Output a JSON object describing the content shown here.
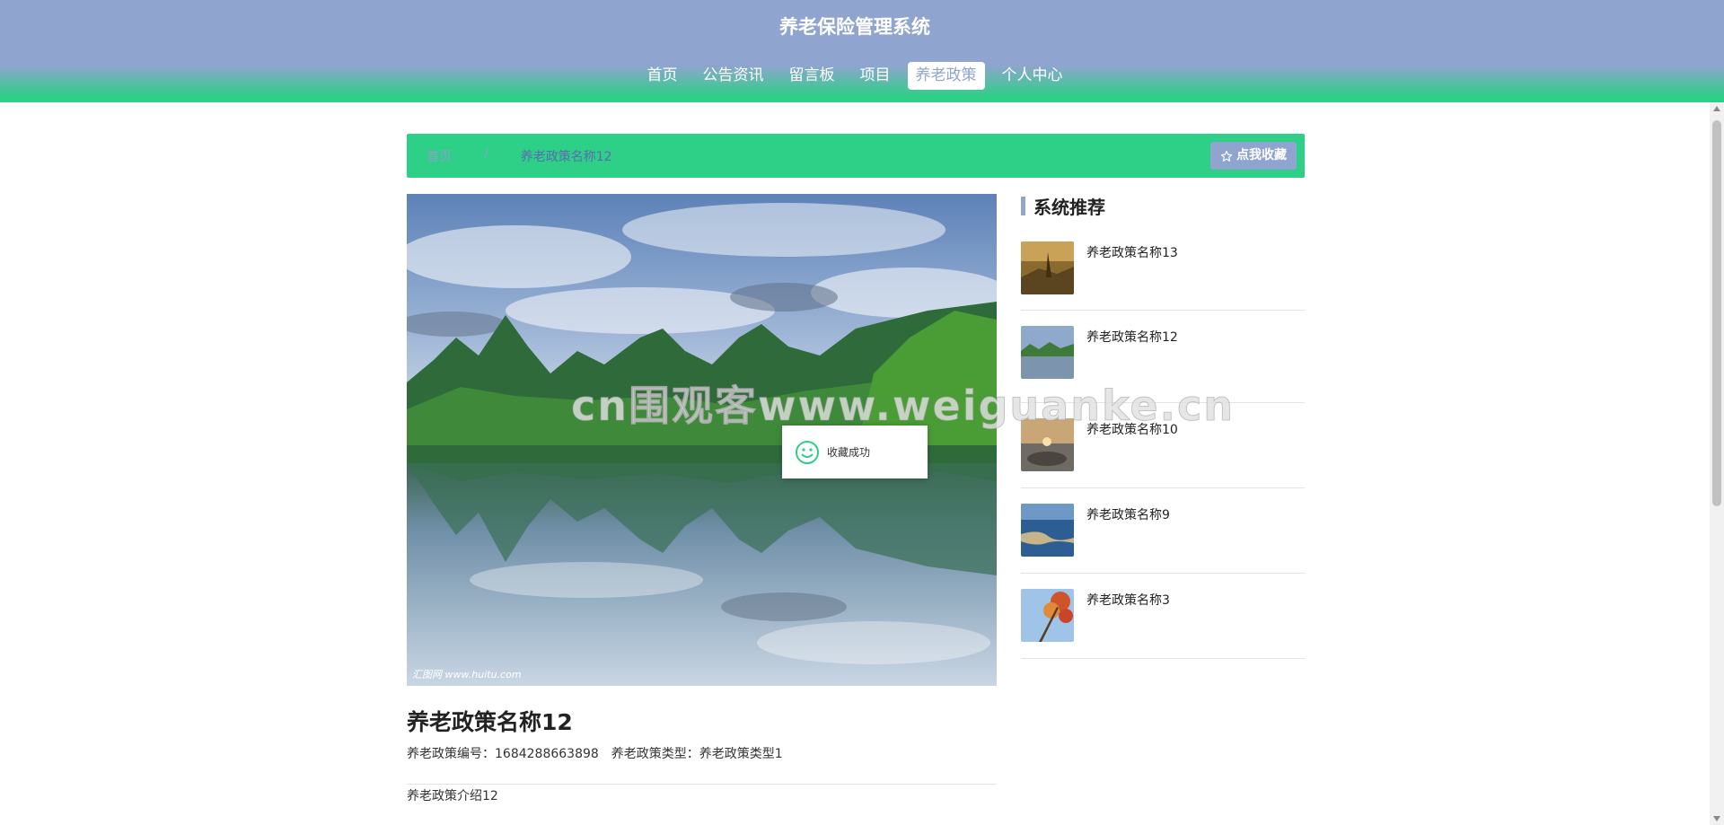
{
  "header": {
    "title": "养老保险管理系统",
    "nav": [
      {
        "label": "首页",
        "active": false
      },
      {
        "label": "公告资讯",
        "active": false
      },
      {
        "label": "留言板",
        "active": false
      },
      {
        "label": "项目",
        "active": false
      },
      {
        "label": "养老政策",
        "active": true
      },
      {
        "label": "个人中心",
        "active": false
      }
    ]
  },
  "breadcrumb": {
    "home": "首页",
    "separator": "/",
    "current": "养老政策名称12"
  },
  "favorite_button": {
    "icon": "star-outline-icon",
    "label": "点我收藏"
  },
  "main_image": {
    "credit": "汇图网 www.huitu.com"
  },
  "detail": {
    "title": "养老政策名称12",
    "code_label": "养老政策编号：",
    "code_value": "1684288663898",
    "type_label": "养老政策类型：",
    "type_value": "养老政策类型1",
    "intro": "养老政策介绍12"
  },
  "sidebar": {
    "title": "系统推荐",
    "items": [
      {
        "name": "养老政策名称13"
      },
      {
        "name": "养老政策名称12"
      },
      {
        "name": "养老政策名称10"
      },
      {
        "name": "养老政策名称9"
      },
      {
        "name": "养老政策名称3"
      }
    ]
  },
  "toast": {
    "icon": "smile-icon",
    "text": "收藏成功"
  },
  "watermark": {
    "text": "cn围观客www.weiguanke.cn"
  },
  "colors": {
    "primary": "#90a4d0",
    "accent": "#2ecf86",
    "toast_icon": "#2ecf86"
  }
}
